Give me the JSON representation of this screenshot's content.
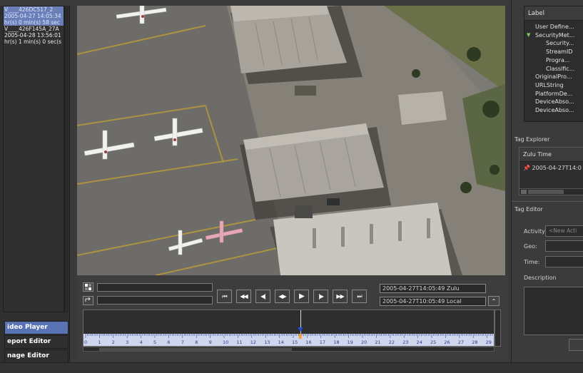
{
  "left_panel": {
    "clips": [
      {
        "lines": [
          "V____426DC517_2",
          "2005-04-27 14:05:34",
          "hr(s) 0 min(s) 58 sec"
        ],
        "selected": true
      },
      {
        "lines": [
          "V____426F145A_27A",
          "2005-04-28 13:56:01",
          "hr(s) 1 min(s) 0 sec(s"
        ],
        "selected": false
      }
    ],
    "nav": [
      {
        "label": "ideo Player",
        "active": true
      },
      {
        "label": "eport Editor",
        "active": false
      },
      {
        "label": "nage Editor",
        "active": false
      }
    ]
  },
  "player": {
    "zulu_time": "2005-04-27T14:05:49 Zulu",
    "local_time": "2005-04-27T10:05:49 Local",
    "buttons": [
      "skip-to-start",
      "rewind",
      "step-back",
      "frame-toggle",
      "play",
      "step-forward",
      "fast-forward",
      "skip-to-end"
    ],
    "timeline": {
      "ticks": [
        "0",
        "1",
        "2",
        "3",
        "4",
        "5",
        "6",
        "7",
        "8",
        "9",
        "10",
        "11",
        "12",
        "13",
        "14",
        "15",
        "16",
        "17",
        "18",
        "19",
        "20",
        "21",
        "22",
        "23",
        "24",
        "25",
        "26",
        "27",
        "28",
        "29"
      ],
      "current_tick": 15.5
    }
  },
  "right_panel": {
    "label_header": "Label",
    "tree": [
      {
        "label": "User Define...",
        "indent": 1,
        "expanded": false
      },
      {
        "label": "SecurityMet...",
        "indent": 1,
        "expanded": true
      },
      {
        "label": "Security...",
        "indent": 2,
        "expanded": false
      },
      {
        "label": "StreamID",
        "indent": 2,
        "expanded": false
      },
      {
        "label": "Progra...",
        "indent": 2,
        "expanded": false
      },
      {
        "label": "Classific...",
        "indent": 2,
        "expanded": false
      },
      {
        "label": "OriginalPro...",
        "indent": 1,
        "expanded": false
      },
      {
        "label": "URLString",
        "indent": 1,
        "expanded": false
      },
      {
        "label": "PlatformDe...",
        "indent": 1,
        "expanded": false
      },
      {
        "label": "DeviceAbso...",
        "indent": 1,
        "expanded": false
      },
      {
        "label": "DeviceAbso...",
        "indent": 1,
        "expanded": false
      }
    ],
    "tag_explorer": {
      "title": "Tag Explorer",
      "column": "Zulu Time",
      "rows": [
        "2005-04-27T14:0"
      ]
    },
    "tag_editor": {
      "title": "Tag Editor",
      "activity_label": "Activity:",
      "activity_placeholder": "<New Acti",
      "geo_label": "Geo:",
      "time_label": "Time:",
      "description_label": "Description"
    }
  }
}
